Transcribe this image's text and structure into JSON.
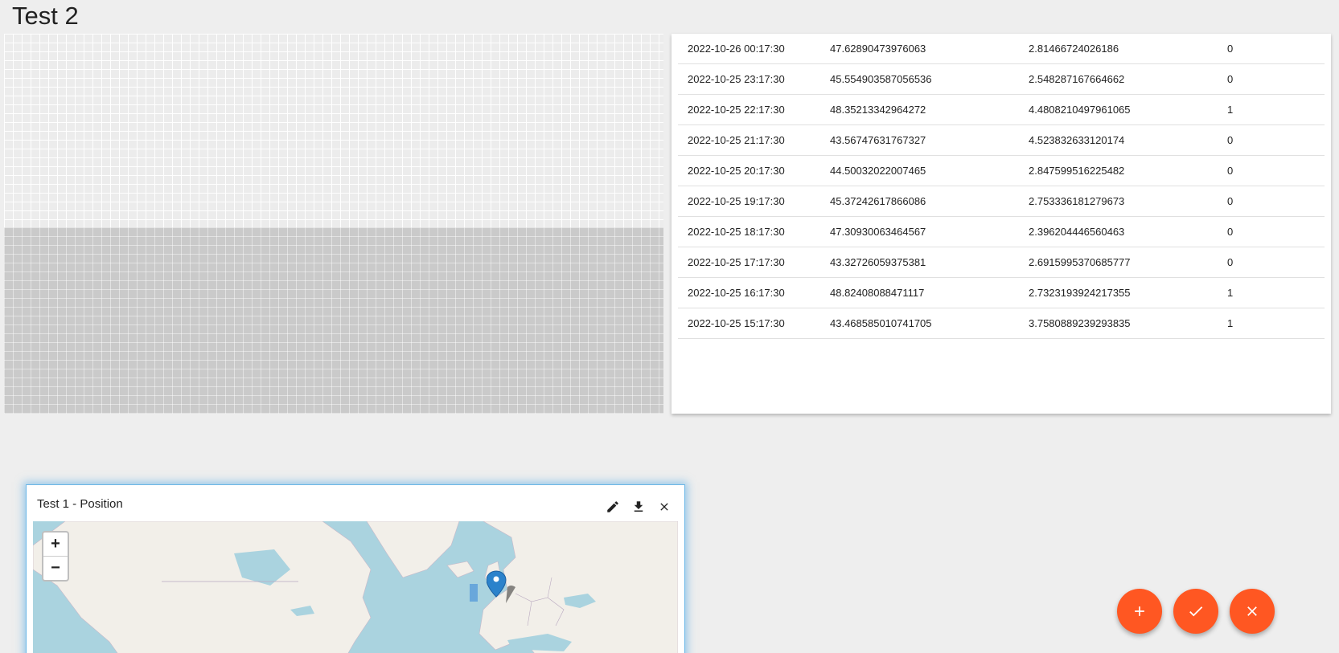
{
  "page": {
    "title": "Test 2"
  },
  "table": {
    "rows": [
      [
        "2022-10-26 00:17:30",
        "47.62890473976063",
        "2.81466724026186",
        "0"
      ],
      [
        "2022-10-25 23:17:30",
        "45.554903587056536",
        "2.548287167664662",
        "0"
      ],
      [
        "2022-10-25 22:17:30",
        "48.35213342964272",
        "4.4808210497961065",
        "1"
      ],
      [
        "2022-10-25 21:17:30",
        "43.56747631767327",
        "4.523832633120174",
        "0"
      ],
      [
        "2022-10-25 20:17:30",
        "44.50032022007465",
        "2.847599516225482",
        "0"
      ],
      [
        "2022-10-25 19:17:30",
        "45.37242617866086",
        "2.753336181279673",
        "0"
      ],
      [
        "2022-10-25 18:17:30",
        "47.30930063464567",
        "2.396204446560463",
        "0"
      ],
      [
        "2022-10-25 17:17:30",
        "43.32726059375381",
        "2.6915995370685777",
        "0"
      ],
      [
        "2022-10-25 16:17:30",
        "48.82408088471117",
        "2.7323193924217355",
        "1"
      ],
      [
        "2022-10-25 15:17:30",
        "43.468585010741705",
        "3.7580889239293835",
        "1"
      ]
    ]
  },
  "map_widget": {
    "title": "Test 1 - Position",
    "actions": {
      "edit_icon": "pencil-icon",
      "download_icon": "download-icon",
      "close_icon": "close-icon"
    },
    "zoom_in": "+",
    "zoom_out": "−",
    "marker_icon": "map-pin-icon",
    "colors": {
      "water": "#aad3df",
      "land": "#f2efe9",
      "marker": "#2b82cb"
    }
  },
  "fabs": [
    {
      "icon": "plus-icon"
    },
    {
      "icon": "check-icon"
    },
    {
      "icon": "close-icon"
    }
  ],
  "colors": {
    "fab": "#ff5722",
    "background": "#eeeeee"
  }
}
